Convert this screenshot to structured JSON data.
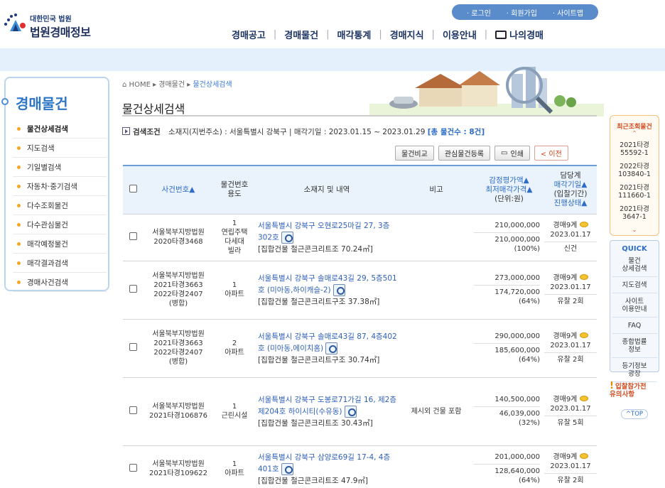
{
  "header": {
    "logo_small": "대한민국 법원",
    "logo_big": "법원경매정보",
    "util": [
      "· 로그인",
      "· 회원가입",
      "· 사이트맵"
    ],
    "gnb": [
      "경매공고",
      "경매물건",
      "매각통계",
      "경매지식",
      "이용안내",
      "나의경매"
    ]
  },
  "lnb": {
    "title": "경매물건",
    "items": [
      "물건상세검색",
      "지도검색",
      "기일별검색",
      "자동차·중기검색",
      "다수조회물건",
      "다수관심물건",
      "매각예정물건",
      "매각결과검색",
      "경매사건검색"
    ]
  },
  "breadcrumb": {
    "home": "HOME",
    "level1": "경매물건",
    "current": "물건상세검색"
  },
  "page_title": "물건상세검색",
  "condition": {
    "label": "검색조건",
    "text": "소재지(지번주소) : 서울특별시 강북구 | 매각기일 : 2023.01.15 ~ 2023.01.29",
    "count": "[총 물건수 : 8건]"
  },
  "buttons": {
    "compare": "물건비교",
    "favorite": "관심물건등록",
    "print": "인쇄",
    "prev": "< 이전"
  },
  "table": {
    "headers": {
      "case": "사건번호▲",
      "item_no": "물건번호",
      "item_use": "용도",
      "location": "소재지 및 내역",
      "remark": "비고",
      "appraisal": "감정평가액▲",
      "min_price": "최저매각가격▲",
      "unit": "(단위:원)",
      "dept": "담당계",
      "sale_date": "매각기일▲",
      "bid_period": "(입찰기간)",
      "status": "진행상태▲"
    },
    "rows": [
      {
        "court": "서울북부지방법원",
        "case1": "2020타경3468",
        "case2": "",
        "case3": "",
        "no": "1",
        "use": "연립주택\n다세대\n빌라",
        "addr": "서울특별시 강북구 오현로25마길 27, 3층302호",
        "detail": "[집합건물 철근콘크리트조 70.24㎡]",
        "remark": "",
        "appraisal": "210,000,000",
        "min_price": "210,000,000",
        "pct": "(100%)",
        "dept": "경매9계",
        "date": "2023.01.17",
        "status": "신건"
      },
      {
        "court": "서울북부지방법원",
        "case1": "2021타경3663",
        "case2": "2022타경2407",
        "case3": "(병합)",
        "no": "1",
        "use": "아파트",
        "addr": "서울특별시 강북구 솔매로43길 29, 5층501호 (미아동,하이캐슬-2)",
        "detail": "[집합건물 철근콘크리트구조 37.38㎡]",
        "remark": "",
        "appraisal": "273,000,000",
        "min_price": "174,720,000",
        "pct": "(64%)",
        "dept": "경매9계",
        "date": "2023.01.17",
        "status": "유찰 2회"
      },
      {
        "court": "서울북부지방법원",
        "case1": "2021타경3663",
        "case2": "2022타경2407",
        "case3": "(병합)",
        "no": "2",
        "use": "아파트",
        "addr": "서울특별시 강북구 솔매로43길 87, 4층402호 (미아동,에이치홈)",
        "detail": "[집합건물 철근콘크리트구조 30.74㎡]",
        "remark": "",
        "appraisal": "290,000,000",
        "min_price": "185,600,000",
        "pct": "(64%)",
        "dept": "경매9계",
        "date": "2023.01.17",
        "status": "유찰 2회"
      },
      {
        "court": "서울북부지방법원",
        "case1": "2021타경106876",
        "case2": "",
        "case3": "",
        "no": "1",
        "use": "근린시설",
        "addr": "서울특별시 강북구 도봉로71가길 16, 제2층 제204호 하이시티(수유동)",
        "detail": "[집합건물 철근콘크리트조 30.43㎡]",
        "remark": "제시외 건물 포함",
        "appraisal": "140,500,000",
        "min_price": "46,039,000",
        "pct": "(32%)",
        "dept": "경매9계",
        "date": "2023.01.17",
        "status": "유찰 5회"
      },
      {
        "court": "서울북부지방법원",
        "case1": "2021타경109622",
        "case2": "",
        "case3": "",
        "no": "1",
        "use": "아파트",
        "addr": "서울특별시 강북구 삼양로69길 17-4, 4층401호",
        "detail": "[집합건물 철근콘크리트조 47.9㎡]",
        "remark": "",
        "appraisal": "201,000,000",
        "min_price": "128,640,000",
        "pct": "(64%)",
        "dept": "경매9계",
        "date": "2023.01.17",
        "status": "유찰 2회"
      }
    ]
  },
  "recent": {
    "title": "최근조회물건",
    "items": [
      "2021타경\n55592-1",
      "2022타경\n103840-1",
      "2021타경\n111660-1",
      "2021타경\n3647-1"
    ]
  },
  "quick": {
    "title": "QUICK",
    "items": [
      "물건\n상세검색",
      "지도검색",
      "사이트\n이용안내",
      "FAQ",
      "종합법률\n정보",
      "등기정보\n광장"
    ]
  },
  "notice": "입찰참가전\n유의사항",
  "top": "^TOP",
  "colors": {
    "accent": "#2c6cc6",
    "header_bg": "#eaf2fb",
    "orange": "#f5a623"
  }
}
